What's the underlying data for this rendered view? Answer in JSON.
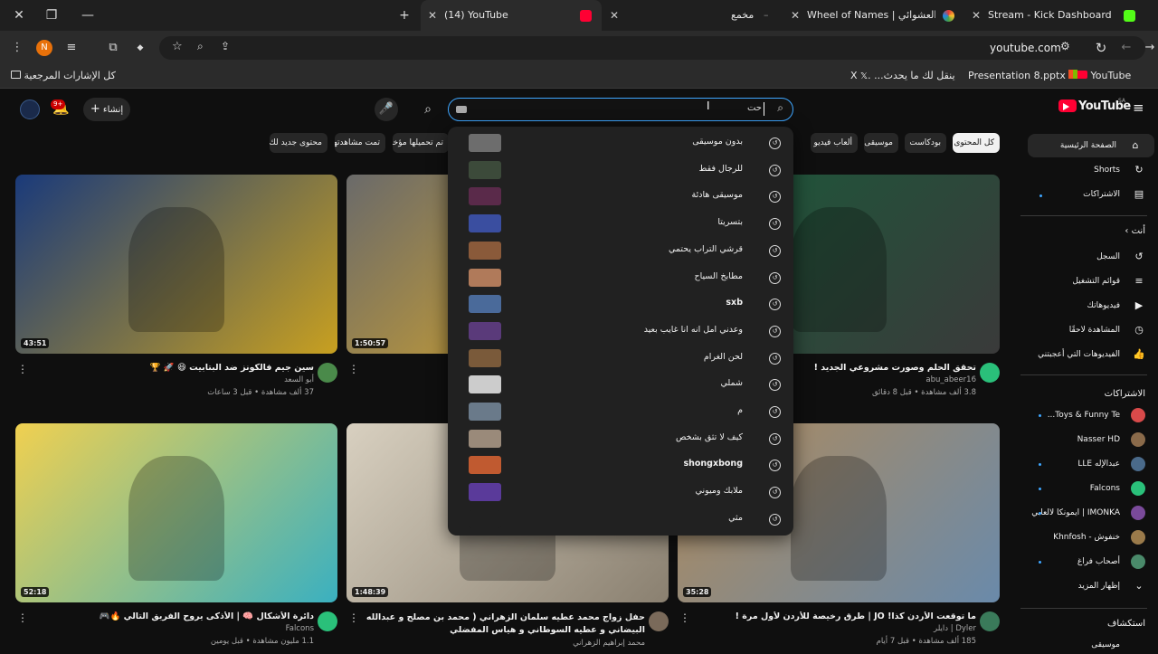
{
  "browser": {
    "tabs": [
      {
        "title": "Stream - Kick Dashboard",
        "fav": "#53fc18"
      },
      {
        "title": "Wheel of Names | اسم العشوائي",
        "fav": "#e8e8e8"
      },
      {
        "title": "مخمع",
        "fav": "#888"
      },
      {
        "title": "(14) YouTube",
        "fav": "#ff0033"
      }
    ],
    "url": "youtube.com",
    "profile_initial": "N",
    "bookmarks": [
      "YouTube",
      "Presentation 8.pptx",
      "ينقل لك ما يحدث... .X",
      "كل الإشارات المرجعية"
    ]
  },
  "header": {
    "logo": "YouTube",
    "region": "SA",
    "search_value": "حت",
    "create_label": "إنشاء",
    "notif_count": "9+"
  },
  "chips": [
    "كل المحتوى",
    "بودكاست",
    "موسيقى",
    "ألعاب فيديو",
    "تم تحميلها مؤخرًا",
    "تمت مشاهدتها",
    "محتوى جديد لك"
  ],
  "suggestions": [
    {
      "text": "بدون موسيقى",
      "c": "#6d6d6d"
    },
    {
      "text": "للرجال فقط",
      "c": "#3c4a3a"
    },
    {
      "text": "موسيقى هادئة",
      "c": "#5a2a4a"
    },
    {
      "text": "بتسريتا",
      "c": "#3a4ea0"
    },
    {
      "text": "قرشي التراب يحتمي",
      "c": "#8a5a3a"
    },
    {
      "text": "مطابخ السياح",
      "c": "#b07a5a"
    },
    {
      "text": "sxb",
      "c": "#4a6a9a"
    },
    {
      "text": "وعدني امل انه انا غايب بعيد",
      "c": "#5a3a7a"
    },
    {
      "text": "لحن الغرام",
      "c": "#7a5a3a"
    },
    {
      "text": "شملي",
      "c": "#cccccc"
    },
    {
      "text": "م",
      "c": "#6a7a8a"
    },
    {
      "text": "كيف لا تثق بشخص",
      "c": "#9a8a7a"
    },
    {
      "text": "shongxbong",
      "c": "#c05a30"
    },
    {
      "text": "ملابك وميوني",
      "c": "#5a3a9a"
    },
    {
      "text": "مثي",
      "c": "#212121"
    }
  ],
  "sidebar": {
    "main": [
      {
        "label": "الصفحة الرئيسية",
        "icon": "⌂"
      },
      {
        "label": "Shorts",
        "icon": "↻"
      },
      {
        "label": "الاشتراكات",
        "icon": "▤"
      }
    ],
    "you_title": "أنت",
    "you": [
      {
        "label": "السجل",
        "icon": "↺"
      },
      {
        "label": "قوائم التشغيل",
        "icon": "≡"
      },
      {
        "label": "فيديوهاتك",
        "icon": "▶"
      },
      {
        "label": "المشاهدة لاحقًا",
        "icon": "◷"
      },
      {
        "label": "الفيديوهات التي أعجبتني",
        "icon": "👍"
      }
    ],
    "subs_title": "الاشتراكات",
    "subs": [
      {
        "label": "Toys & Funny Te...",
        "c": "#d84a4a"
      },
      {
        "label": "Nasser HD",
        "c": "#8a6a4a"
      },
      {
        "label": "عبدالإله LLE",
        "c": "#4a6a8a"
      },
      {
        "label": "Falcons",
        "c": "#2ac07a"
      },
      {
        "label": "IMONKA | ايمونكا لالعابي",
        "c": "#7a4a9a"
      },
      {
        "label": "خنفوش - Khnfosh",
        "c": "#9a7a4a"
      },
      {
        "label": "أصحاب فراغ",
        "c": "#4a8a6a"
      },
      {
        "label": "إظهار المزيد",
        "c": ""
      }
    ],
    "explore_title": "استكشاف",
    "explore_first": "موسيقى"
  },
  "videos": [
    {
      "title": "تحقق الحلم وصورت مشروعي الجديد !",
      "channel": "abu_abeer16",
      "stats": "3.8 ألف مشاهدة • قبل 8 دقائق",
      "dur": "",
      "c1": "#1a5a3a",
      "c2": "#3a3a3a",
      "av": "#2ac07a"
    },
    {
      "title": "",
      "channel": "",
      "stats": "",
      "dur": "1:50:57",
      "c1": "#6a6a6a",
      "c2": "#e8b020",
      "av": "#444"
    },
    {
      "title": "سين جيم فالكونز ضد البتابيت 😆 🚀 🏆",
      "channel": "أبو السعد",
      "stats": "37 ألف مشاهدة • قبل 3 ساعات",
      "dur": "43:51",
      "c1": "#1a3a7a",
      "c2": "#c8a020",
      "av": "#4a8a4a"
    },
    {
      "title": "ما توقعت الأردن كذا! JO | طرق رخيصة للأردن لأول مرة !",
      "channel": "Dyler | دايلر",
      "stats": "185 ألف مشاهدة • قبل 7 أيام",
      "dur": "35:28",
      "c1": "#b08a5a",
      "c2": "#6a8aaa",
      "av": "#3a7a5a"
    },
    {
      "title": "حفل زواج محمد عطيه سلمان الزهراني ( محمد بن مصلح و عبدالله البيضاني و عطيه السوطاني و هياس المفضلي",
      "channel": "محمد إبراهيم الزهراني",
      "stats": "",
      "dur": "1:48:39",
      "c1": "#d8d0c0",
      "c2": "#8a8070",
      "av": "#7a6a5a"
    },
    {
      "title": "دائرة الأشكال 🧠 | الأذكى يروح الفريق التالي 🔥🎮",
      "channel": "Falcons",
      "stats": "1.1 مليون مشاهدة • قبل يومين",
      "dur": "52:18",
      "c1": "#f0d050",
      "c2": "#3ab0c0",
      "av": "#2ac07a"
    }
  ]
}
